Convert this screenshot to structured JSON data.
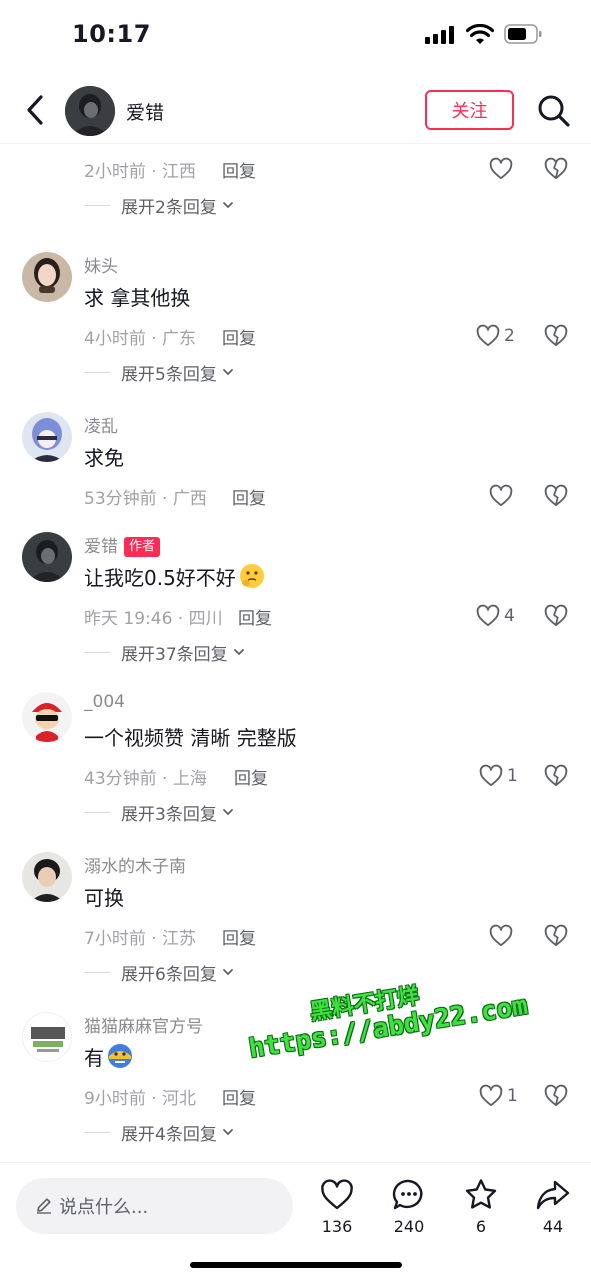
{
  "status_bar": {
    "time": "10:17"
  },
  "header": {
    "username": "爱错",
    "follow_label": "关注"
  },
  "top_partial": {
    "meta": "2小时前 · 江西",
    "reply_label": "回复",
    "expand_label": "展开2条回复"
  },
  "comments": [
    {
      "username": "妹头",
      "text": "求  拿其他换",
      "meta": "4小时前 · 广东",
      "reply_label": "回复",
      "likes": "2",
      "expand_label": "展开5条回复"
    },
    {
      "username": "凌乱",
      "text": "求免",
      "meta": "53分钟前 · 广西",
      "reply_label": "回复",
      "likes": "",
      "expand_label": ""
    },
    {
      "username": "爱错",
      "badge": "作者",
      "text": "让我吃0.5好不好",
      "meta": "昨天 19:46 · 四川",
      "reply_label": "回复",
      "likes": "4",
      "expand_label": "展开37条回复"
    },
    {
      "username": "_004",
      "text": "一个视频赞 清晰 完整版",
      "meta": "43分钟前 · 上海",
      "reply_label": "回复",
      "likes": "1",
      "expand_label": "展开3条回复"
    },
    {
      "username": "溺水的木子南",
      "text": "可换",
      "meta": "7小时前 · 江苏",
      "reply_label": "回复",
      "likes": "",
      "expand_label": "展开6条回复"
    },
    {
      "username": "猫猫麻麻官方号",
      "text": "有",
      "meta": "9小时前 · 河北",
      "reply_label": "回复",
      "likes": "1",
      "expand_label": "展开4条回复"
    }
  ],
  "watermark": {
    "line1": "黑料不打烊",
    "line2": "https://abdy22.com"
  },
  "bottom_bar": {
    "input_placeholder": "说点什么...",
    "like_count": "136",
    "comment_count": "240",
    "favorite_count": "6",
    "share_count": "44"
  },
  "colors": {
    "accent": "#fe2c55",
    "text_primary": "#161823",
    "text_secondary": "#8a8b91",
    "watermark": "#3fe040"
  },
  "icons": [
    "back-icon",
    "search-icon",
    "heart-icon",
    "broken-heart-icon",
    "chevron-down-icon",
    "pencil-icon",
    "comment-icon",
    "star-icon",
    "share-icon"
  ]
}
